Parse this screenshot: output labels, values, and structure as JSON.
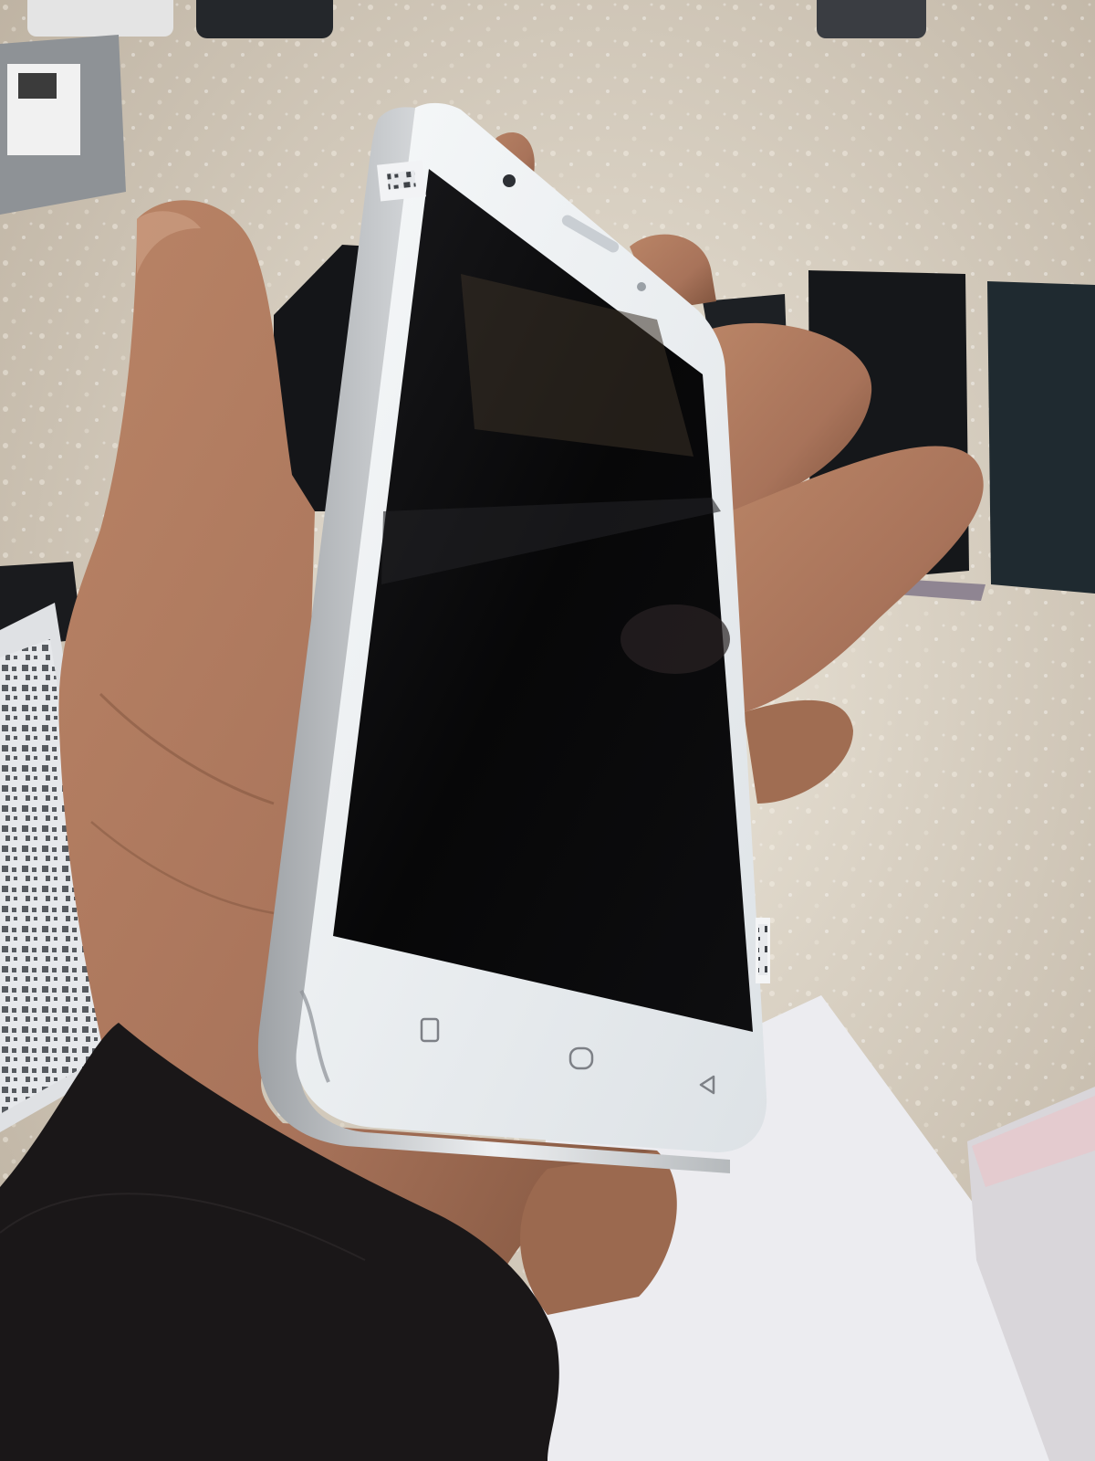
{
  "scene": {
    "description_type": "photo",
    "colors": {
      "background": "#d8d0c4",
      "sparkle": "#f4efe6",
      "skin": "#b07a5c",
      "skin_shadow": "#7d523c",
      "sleeve": "#1a1718",
      "phone_body": "#eef1f3",
      "phone_frame": "#c9ccce",
      "screen": "#0b0b0d",
      "paper": "#ececf0",
      "other_phone": "#1f2226"
    }
  },
  "phone": {
    "nav_buttons": [
      {
        "icon": "recent-apps-icon"
      },
      {
        "icon": "home-icon"
      },
      {
        "icon": "back-icon"
      }
    ]
  }
}
